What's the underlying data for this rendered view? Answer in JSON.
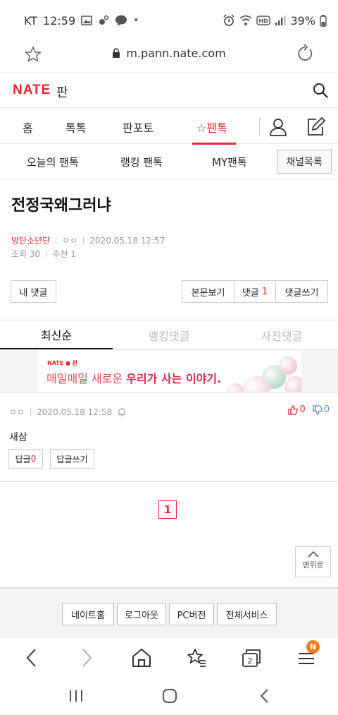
{
  "status": {
    "carrier": "KT",
    "time": "12:59",
    "dot": "•",
    "battery": "39%"
  },
  "browser": {
    "url": "m.pann.nate.com"
  },
  "site": {
    "logo": "NATE",
    "section": "판"
  },
  "nav": {
    "items": [
      {
        "label": "홈"
      },
      {
        "label": "톡톡"
      },
      {
        "label": "판포토"
      },
      {
        "label": "팬톡"
      }
    ],
    "active_icon": "☆"
  },
  "subnav": {
    "items": [
      {
        "label": "오늘의 팬톡"
      },
      {
        "label": "랭킹 팬톡"
      },
      {
        "label": "MY팬톡"
      }
    ],
    "channel_button": "채널목록"
  },
  "post": {
    "title": "전정국왜그러냐",
    "author": "방탄소년단",
    "nickname": "ㅇㅇ",
    "date": "2020.05.18 12:57",
    "views_label": "조회",
    "views": "30",
    "likes_label": "추천",
    "likes": "1"
  },
  "actions": {
    "my_comments": "내 댓글",
    "view_post": "본문보기",
    "comments_label": "댓글",
    "comments_count": "1",
    "write_comment": "댓글쓰기"
  },
  "sort_tabs": [
    {
      "label": "최신순"
    },
    {
      "label": "랭킹댓글"
    },
    {
      "label": "사진댓글"
    }
  ],
  "banner": {
    "brand": "NATE ● 판",
    "text_plain": "매일매일 새로운 ",
    "text_bold": "우리가 사는 이야기."
  },
  "comment": {
    "nickname": "ㅇㅇ",
    "date": "2020.05.18 12:58",
    "up": "0",
    "down": "0",
    "text": "새삼",
    "reply_label": "답글",
    "reply_count": "0",
    "write_reply": "답글쓰기"
  },
  "pager": {
    "current": "1"
  },
  "top_button": "맨위로",
  "footer": {
    "buttons": [
      {
        "label": "네이트홈"
      },
      {
        "label": "로그아웃"
      },
      {
        "label": "PC버전"
      },
      {
        "label": "전체서비스"
      }
    ]
  },
  "browser_toolbar": {
    "tabs_count": "2",
    "menu_badge": "N"
  },
  "colors": {
    "accent": "#e8262e",
    "badge": "#f07d1a"
  }
}
